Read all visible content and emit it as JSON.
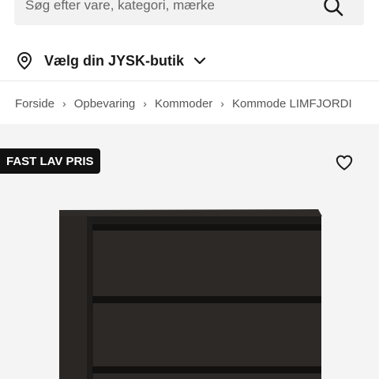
{
  "search": {
    "placeholder": "Søg efter vare, kategori, mærke"
  },
  "store_selector": {
    "label": "Vælg din JYSK-butik"
  },
  "breadcrumb": [
    "Forside",
    "Opbevaring",
    "Kommoder",
    "Kommode LIMFJORDI"
  ],
  "product": {
    "badge": "FAST LAV PRIS",
    "icons": {
      "wishlist": "heart-icon",
      "search": "search-icon",
      "location": "location-pin-icon"
    }
  },
  "colors": {
    "badge_bg": "#111111",
    "search_bg": "#f2f2f2",
    "image_bg": "#f4f4f4"
  }
}
